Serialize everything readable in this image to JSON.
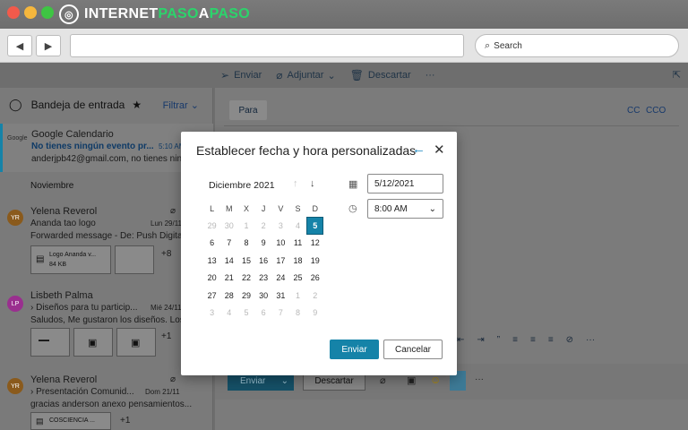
{
  "browser": {
    "logo_text_1": "INTERNET",
    "logo_text_2": "PASO",
    "logo_text_3": "A",
    "logo_text_4": "PASO",
    "back_icon": "◀",
    "forward_icon": "▶",
    "search_placeholder": "Search"
  },
  "toolbar": {
    "send_label": "Enviar",
    "attach_label": "Adjuntar",
    "discard_label": "Descartar",
    "more_label": "···"
  },
  "inbox": {
    "title": "Bandeja de entrada",
    "filter_label": "Filtrar",
    "section_label": "Noviembre",
    "mails": [
      {
        "sender": "Google Calendario",
        "subject": "No tienes ningún evento pr...",
        "time": "5:10 AM",
        "preview": "anderjpb42@gmail.com, no tienes nin...",
        "tag": "Google"
      },
      {
        "initials": "YR",
        "sender": "Yelena Reverol",
        "subject": "Ananda tao logo",
        "time": "Lun 29/11",
        "preview": "Forwarded message - De: Push Digital...",
        "attachment_name": "Logo Ananda v...",
        "attachment_size": "84 KB",
        "more": "+8"
      },
      {
        "initials": "LP",
        "sender": "Lisbeth Palma",
        "subject": "Diseños para tu particip...",
        "time": "Mié 24/11",
        "preview": "Saludos, Me gustaron los diseños. Los...",
        "more": "+1"
      },
      {
        "initials": "YR",
        "sender": "Yelena Reverol",
        "subject": "Presentación Comunid...",
        "time": "Dom 21/11",
        "preview": "gracias anderson anexo pensamientos...",
        "attachment_name": "COSCIENCIA ...",
        "more": "+1"
      }
    ]
  },
  "compose": {
    "to_label": "Para",
    "cc_label": "CC",
    "cco_label": "CCO",
    "send_label": "Enviar",
    "discard_label": "Descartar"
  },
  "dialog": {
    "title": "Establecer fecha y hora personalizadas",
    "month_label": "Diciembre 2021",
    "weekdays": [
      "L",
      "M",
      "X",
      "J",
      "V",
      "S",
      "D"
    ],
    "weeks": [
      [
        "29",
        "30",
        "1",
        "2",
        "3",
        "4",
        "5"
      ],
      [
        "6",
        "7",
        "8",
        "9",
        "10",
        "11",
        "12"
      ],
      [
        "13",
        "14",
        "15",
        "16",
        "17",
        "18",
        "19"
      ],
      [
        "20",
        "21",
        "22",
        "23",
        "24",
        "25",
        "26"
      ],
      [
        "27",
        "28",
        "29",
        "30",
        "31",
        "1",
        "2"
      ],
      [
        "3",
        "4",
        "5",
        "6",
        "7",
        "8",
        "9"
      ]
    ],
    "date_value": "5/12/2021",
    "time_value": "8:00 AM",
    "send_label": "Enviar",
    "cancel_label": "Cancelar"
  },
  "colors": {
    "accent": "#1583a8",
    "link": "#17396b"
  }
}
